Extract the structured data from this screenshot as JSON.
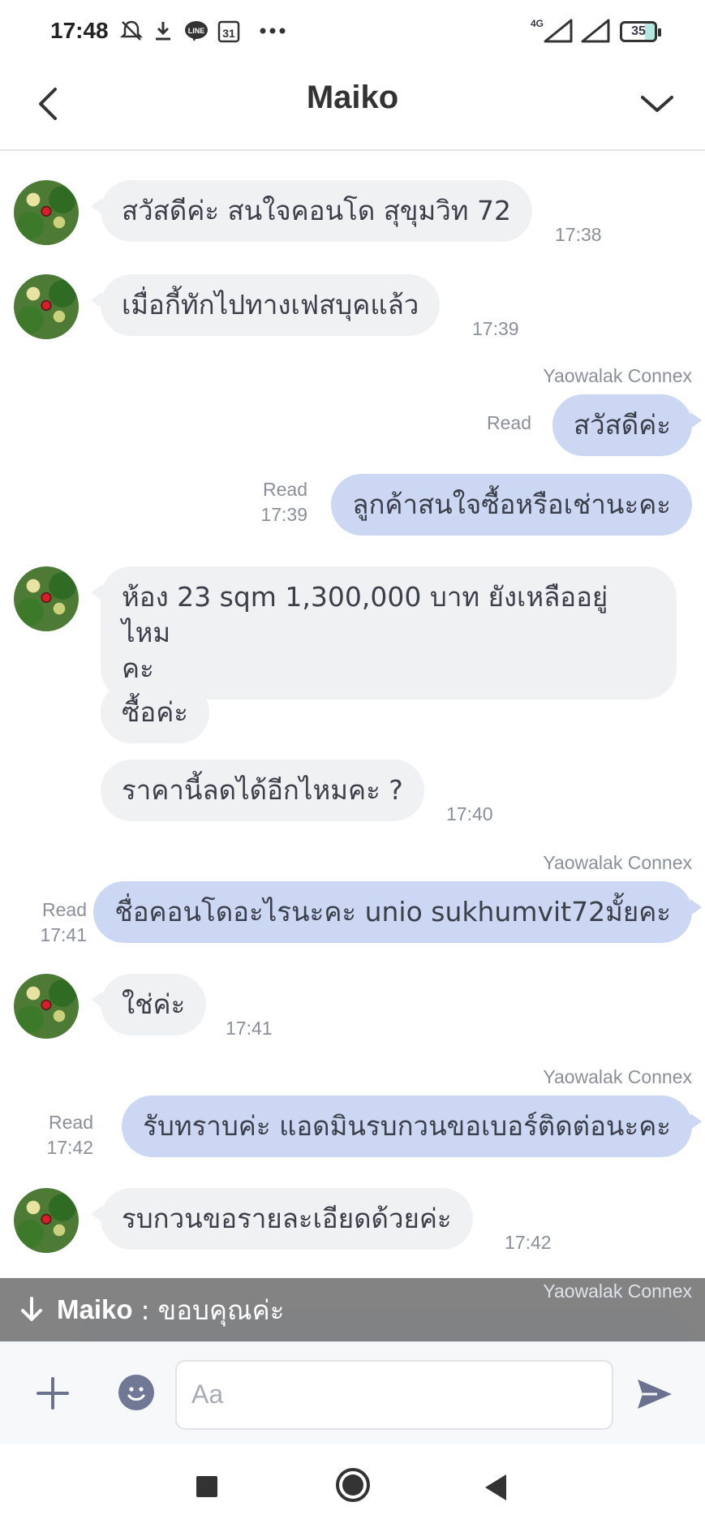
{
  "status_bar": {
    "time": "17:48",
    "calendar_day": "31",
    "network": "4G",
    "battery": "35"
  },
  "header": {
    "title": "Maiko"
  },
  "messages": [
    {
      "dir": "in",
      "text": "สวัสดีค่ะ สนใจคอนโด สุขุมวิท 72",
      "time": "17:38"
    },
    {
      "dir": "in",
      "text": "เมื่อกี้ทักไปทางเฟสบุคแล้ว",
      "time": "17:39"
    },
    {
      "dir": "out",
      "sender": "Yaowalak Connex",
      "text": "สวัสดีค่ะ",
      "read": "Read"
    },
    {
      "dir": "out",
      "text": "ลูกค้าสนใจซื้อหรือเช่านะคะ",
      "read": "Read",
      "time": "17:39"
    },
    {
      "dir": "in",
      "text_line1": "ห้อง 23 sqm 1,300,000 บาท ยังเหลืออยู่ไหม",
      "text_line2": "คะ"
    },
    {
      "dir": "in",
      "text": "ซื้อค่ะ"
    },
    {
      "dir": "in",
      "text": "ราคานี้ลดได้อีกไหมคะ ?",
      "time": "17:40"
    },
    {
      "dir": "out",
      "sender": "Yaowalak Connex",
      "text": "ชื่อคอนโดอะไรนะคะ unio sukhumvit72มั้ยคะ",
      "read": "Read",
      "time": "17:41"
    },
    {
      "dir": "in",
      "text": "ใช่ค่ะ",
      "time": "17:41"
    },
    {
      "dir": "out",
      "sender": "Yaowalak Connex",
      "text": "รับทราบค่ะ แอดมินรบกวนขอเบอร์ติดต่อนะคะ",
      "read": "Read",
      "time": "17:42"
    },
    {
      "dir": "in",
      "text": "รบกวนขอรายละเอียดด้วยค่ะ",
      "time": "17:42"
    },
    {
      "dir": "out",
      "sender": "Yaowalak Connex"
    }
  ],
  "banner": {
    "name": "Maiko",
    "separator": ":",
    "text": "ขอบคุณค่ะ"
  },
  "input": {
    "placeholder": "Aa"
  }
}
